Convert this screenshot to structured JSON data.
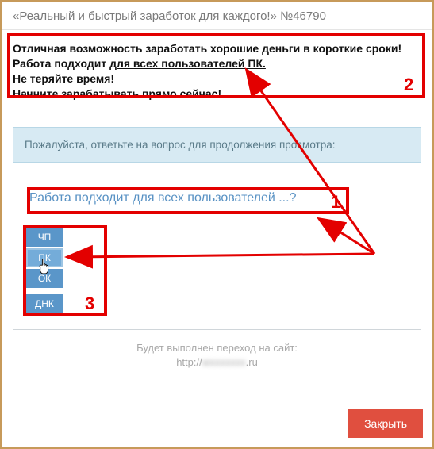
{
  "title": "«Реальный и быстрый заработок для каждого!» №46790",
  "ad": {
    "line1": "Отличная возможность заработать хорошие деньги в короткие сроки!",
    "line2a": "Работа подходит ",
    "line2b": "для всех пользователей ПК.",
    "line3": "Не теряйте время!",
    "line4": "Начните зарабатывать прямо сейчас!"
  },
  "notice": "Пожалуйста, ответьте на вопрос для продолжения просмотра:",
  "question": "Работа подходит для всех пользователей ...?",
  "options": [
    "ЧП",
    "ПК",
    "ОК",
    "ДНК"
  ],
  "selected_index": 1,
  "annotations": {
    "n1": "1",
    "n2": "2",
    "n3": "3"
  },
  "footer": {
    "line1": "Будет выполнен переход на сайт:",
    "url_prefix": "http://",
    "url_hidden": "wxxxxxxx",
    "url_suffix": ".ru"
  },
  "close": "Закрыть",
  "colors": {
    "accent_red": "#e30000",
    "btn_red": "#e04f3f",
    "option_blue": "#5a96c9"
  }
}
